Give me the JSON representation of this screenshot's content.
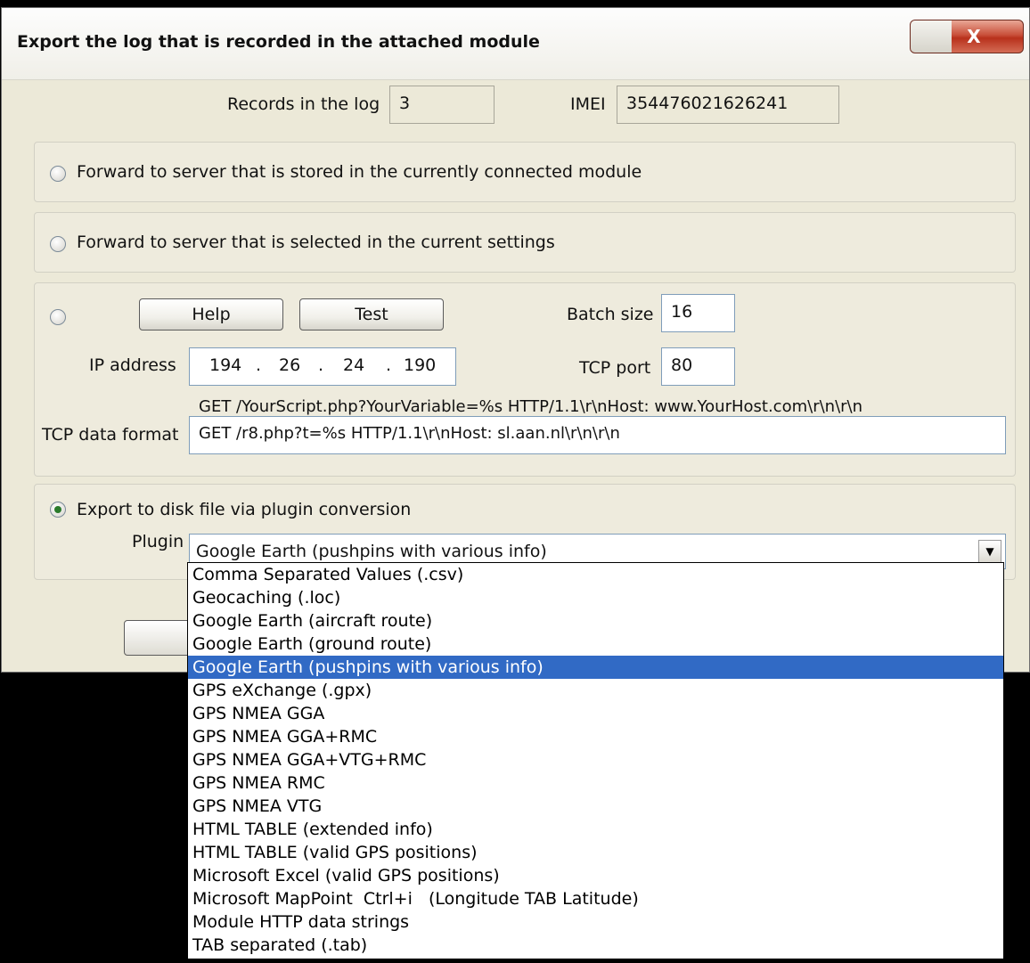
{
  "window": {
    "title": "Export the log that is recorded in the attached module",
    "close_label": "X"
  },
  "info": {
    "records_label": "Records in the log",
    "records_value": "3",
    "imei_label": "IMEI",
    "imei_value": "354476021626241"
  },
  "options": {
    "forward_stored_label": "Forward to server that is stored in the currently connected module",
    "forward_selected_label": "Forward to server that is selected in the current settings",
    "export_disk_label": "Export to disk file via plugin conversion"
  },
  "custom": {
    "help_label": "Help",
    "test_label": "Test",
    "batch_label": "Batch size",
    "batch_value": "16",
    "ip_label": "IP address",
    "ip": [
      "194",
      "26",
      "24",
      "190"
    ],
    "tcp_port_label": "TCP port",
    "tcp_port_value": "80",
    "format_hint": "GET /YourScript.php?YourVariable=%s HTTP/1.1\\r\\nHost: www.YourHost.com\\r\\n\\r\\n",
    "format_label": "TCP data format",
    "format_value": "GET /r8.php?t=%s HTTP/1.1\\r\\nHost: sl.aan.nl\\r\\n\\r\\n"
  },
  "plugin": {
    "label": "Plugin",
    "selected": "Google Earth (pushpins with various info)",
    "selected_index": 4,
    "options": [
      "Comma Separated Values (.csv)",
      "Geocaching (.loc)",
      "Google Earth (aircraft route)",
      "Google Earth (ground route)",
      "Google Earth (pushpins with various info)",
      "GPS eXchange (.gpx)",
      "GPS NMEA GGA",
      "GPS NMEA GGA+RMC",
      "GPS NMEA GGA+VTG+RMC",
      "GPS NMEA RMC",
      "GPS NMEA VTG",
      "HTML TABLE (extended info)",
      "HTML TABLE (valid GPS positions)",
      "Microsoft Excel (valid GPS positions)",
      "Microsoft MapPoint  Ctrl+i   (Longitude TAB Latitude)",
      "Module HTTP data strings",
      "TAB separated (.tab)"
    ]
  }
}
